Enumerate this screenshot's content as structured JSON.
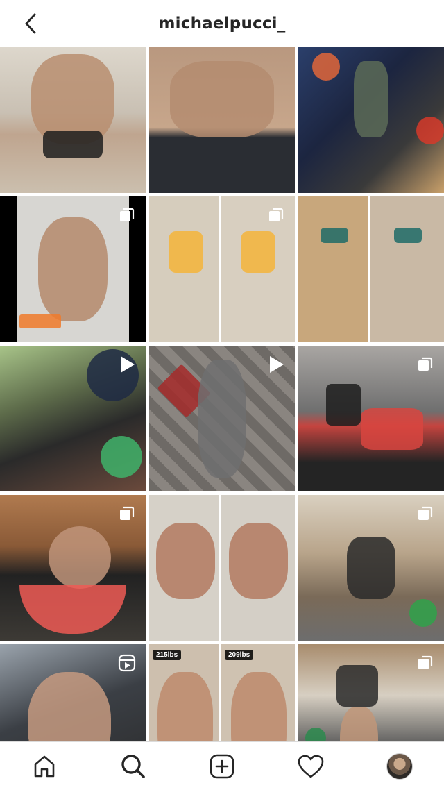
{
  "header": {
    "title": "michaelpucci_"
  },
  "grid": {
    "tiles": [
      {
        "id": "post-1",
        "overlay": "none"
      },
      {
        "id": "post-2",
        "overlay": "none"
      },
      {
        "id": "post-3",
        "overlay": "none"
      },
      {
        "id": "post-4",
        "overlay": "carousel-icon"
      },
      {
        "id": "post-5",
        "overlay": "carousel-icon"
      },
      {
        "id": "post-6",
        "overlay": "none"
      },
      {
        "id": "post-7",
        "overlay": "play-icon"
      },
      {
        "id": "post-8",
        "overlay": "play-icon"
      },
      {
        "id": "post-9",
        "overlay": "carousel-icon"
      },
      {
        "id": "post-10",
        "overlay": "carousel-icon"
      },
      {
        "id": "post-11",
        "overlay": "none"
      },
      {
        "id": "post-12",
        "overlay": "carousel-icon"
      },
      {
        "id": "post-13",
        "overlay": "reels-icon"
      },
      {
        "id": "post-14",
        "overlay": "none",
        "badges": [
          "215lbs",
          "209lbs"
        ]
      },
      {
        "id": "post-15",
        "overlay": "carousel-icon"
      }
    ]
  },
  "tabbar": {
    "items": [
      "home-icon",
      "search-icon",
      "new-post-icon",
      "activity-heart-icon",
      "profile-avatar"
    ]
  },
  "colors": {
    "background": "#ffffff",
    "text": "#262626",
    "divider": "#dbdbdb"
  }
}
